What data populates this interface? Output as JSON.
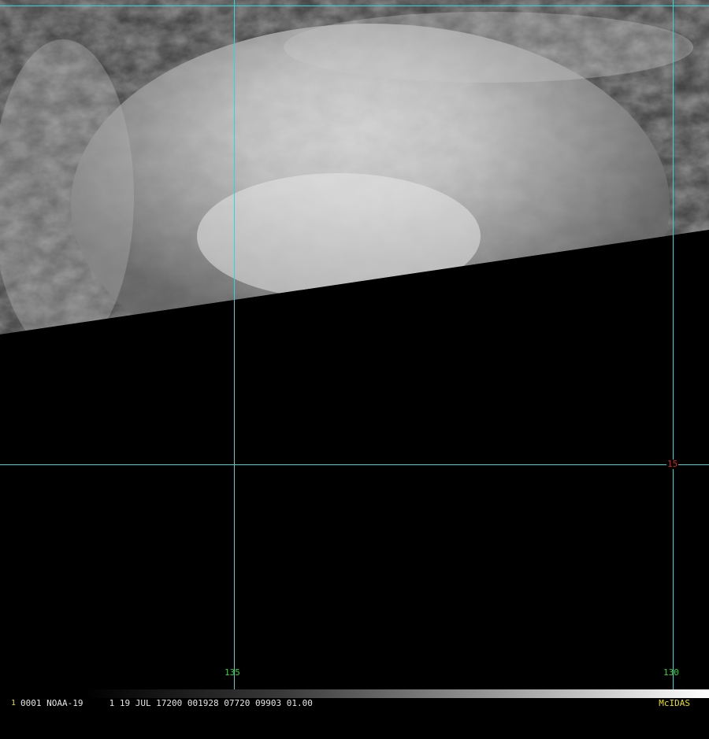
{
  "image": {
    "description_colors": {
      "background": "#000000",
      "gridline": "#33d6d6",
      "longitude_label": "#2fd42f",
      "latitude_label": "#e02020",
      "brand": "#e8e000"
    }
  },
  "grid": {
    "longitudes": [
      {
        "label": "135"
      },
      {
        "label": "130"
      }
    ],
    "latitudes": [
      {
        "label": "15"
      }
    ]
  },
  "status": {
    "frame": "1",
    "text": "0001 NOAA-19     1 19 JUL 17200 001928 07720 09903 01.00",
    "brand": "McIDAS"
  }
}
